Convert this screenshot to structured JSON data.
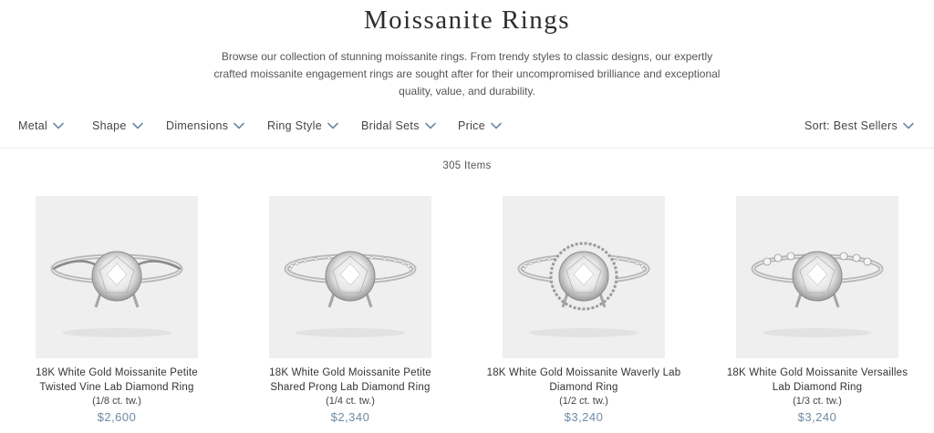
{
  "page": {
    "title": "Moissanite Rings",
    "intro": "Browse our collection of stunning moissanite rings. From trendy styles to classic designs, our expertly crafted moissanite engagement rings are sought after for their uncompromised brilliance and exceptional quality, value, and durability."
  },
  "filters": [
    {
      "label": "Metal",
      "icon": "chevron-down-icon"
    },
    {
      "label": "Shape",
      "icon": "chevron-down-icon"
    },
    {
      "label": "Dimensions",
      "icon": "chevron-down-icon"
    },
    {
      "label": "Ring Style",
      "icon": "chevron-down-icon"
    },
    {
      "label": "Bridal Sets",
      "icon": "chevron-down-icon"
    },
    {
      "label": "Price",
      "icon": "chevron-down-icon"
    }
  ],
  "sort": {
    "label": "Sort: Best Sellers",
    "icon": "chevron-down-icon"
  },
  "results": {
    "count": "305 Items"
  },
  "products": [
    {
      "name": "18K White Gold Moissanite Petite Twisted Vine Lab Diamond Ring",
      "carat": "(1/8 ct. tw.)",
      "price": "$2,600",
      "style": "twisted"
    },
    {
      "name": "18K White Gold Moissanite Petite Shared Prong Lab Diamond Ring",
      "carat": "(1/4 ct. tw.)",
      "price": "$2,340",
      "style": "pave"
    },
    {
      "name": "18K White Gold Moissanite Waverly Lab Diamond Ring",
      "carat": "(1/2 ct. tw.)",
      "price": "$3,240",
      "style": "halo"
    },
    {
      "name": "18K White Gold Moissanite Versailles Lab Diamond Ring",
      "carat": "(1/3 ct. tw.)",
      "price": "$3,240",
      "style": "accent"
    }
  ],
  "colors": {
    "accent": "#6f8aa5",
    "image_bg": "#efefef",
    "text": "#333333"
  }
}
